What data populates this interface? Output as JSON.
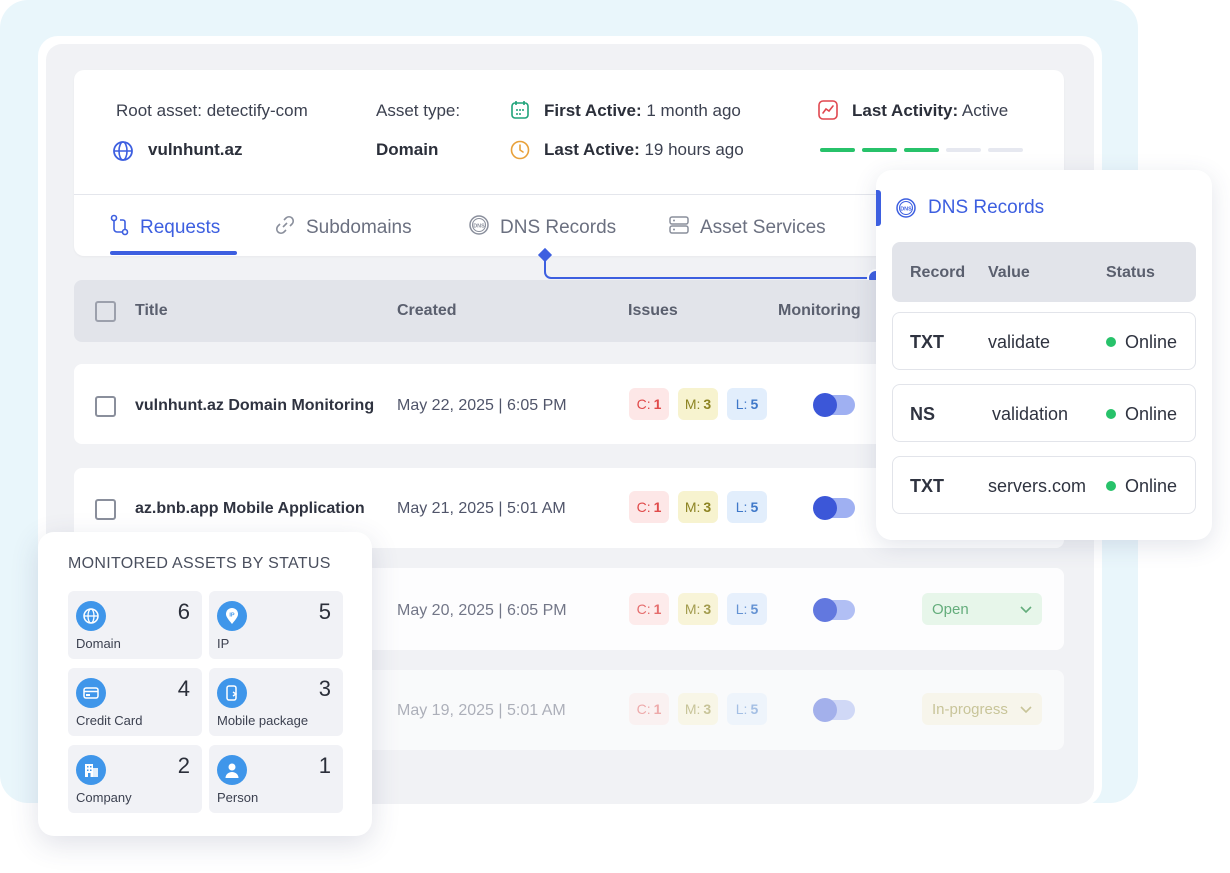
{
  "asset": {
    "root_label": "Root asset: detectify-com",
    "domain_name": "vulnhunt.az",
    "type_label": "Asset type:",
    "type_value": "Domain",
    "first_active_label": "First Active:",
    "first_active_value": "1 month ago",
    "last_active_label": "Last Active:",
    "last_active_value": "19 hours ago",
    "last_activity_label": "Last Activity:",
    "last_activity_value": "Active",
    "activity_level": 0.6
  },
  "tabs": [
    {
      "label": "Requests",
      "icon": "git-pull-icon",
      "active": true
    },
    {
      "label": "Subdomains",
      "icon": "link-icon",
      "active": false
    },
    {
      "label": "DNS Records",
      "icon": "dns-icon",
      "active": false
    },
    {
      "label": "Asset Services",
      "icon": "server-icon",
      "active": false
    }
  ],
  "table": {
    "headers": [
      "Title",
      "Created",
      "Issues",
      "Monitoring"
    ],
    "rows": [
      {
        "title": "vulnhunt.az Domain Monitoring",
        "created": "May 22, 2025 | 6:05 PM",
        "c_label": "C:",
        "c": "1",
        "m_label": "M:",
        "m": "3",
        "l_label": "L:",
        "l": "5",
        "monitoring": true
      },
      {
        "title": "az.bnb.app Mobile Application",
        "created": "May 21, 2025 | 5:01 AM",
        "c_label": "C:",
        "c": "1",
        "m_label": "M:",
        "m": "3",
        "l_label": "L:",
        "l": "5",
        "monitoring": true
      },
      {
        "title": "",
        "created": "May 20, 2025 | 6:05 PM",
        "c_label": "C:",
        "c": "1",
        "m_label": "M:",
        "m": "3",
        "l_label": "L:",
        "l": "5",
        "monitoring": true,
        "status": "Open"
      },
      {
        "title": "",
        "created": "May 19, 2025 | 5:01 AM",
        "c_label": "C:",
        "c": "1",
        "m_label": "M:",
        "m": "3",
        "l_label": "L:",
        "l": "5",
        "monitoring": true,
        "status": "In-progress"
      }
    ]
  },
  "dns": {
    "title": "DNS Records",
    "headers": [
      "Record",
      "Value",
      "Status"
    ],
    "records": [
      {
        "record": "TXT",
        "value": "validate",
        "status": "Online"
      },
      {
        "record": "NS",
        "value": "validation",
        "status": "Online"
      },
      {
        "record": "TXT",
        "value": "servers.com",
        "status": "Online"
      }
    ]
  },
  "monitored_assets": {
    "title": "MONITORED ASSETS BY STATUS",
    "items": [
      {
        "label": "Domain",
        "count": "6",
        "icon": "globe-icon"
      },
      {
        "label": "IP",
        "count": "5",
        "icon": "ip-pin-icon"
      },
      {
        "label": "Credit Card",
        "count": "4",
        "icon": "credit-card-icon"
      },
      {
        "label": "Mobile package",
        "count": "3",
        "icon": "mobile-icon"
      },
      {
        "label": "Company",
        "count": "2",
        "icon": "building-icon"
      },
      {
        "label": "Person",
        "count": "1",
        "icon": "person-icon"
      }
    ]
  },
  "colors": {
    "accent": "#3d5fe0",
    "active_green": "#27c26a",
    "critical": "#e04a4a",
    "medium": "#8d8423",
    "low": "#3f78c9"
  }
}
